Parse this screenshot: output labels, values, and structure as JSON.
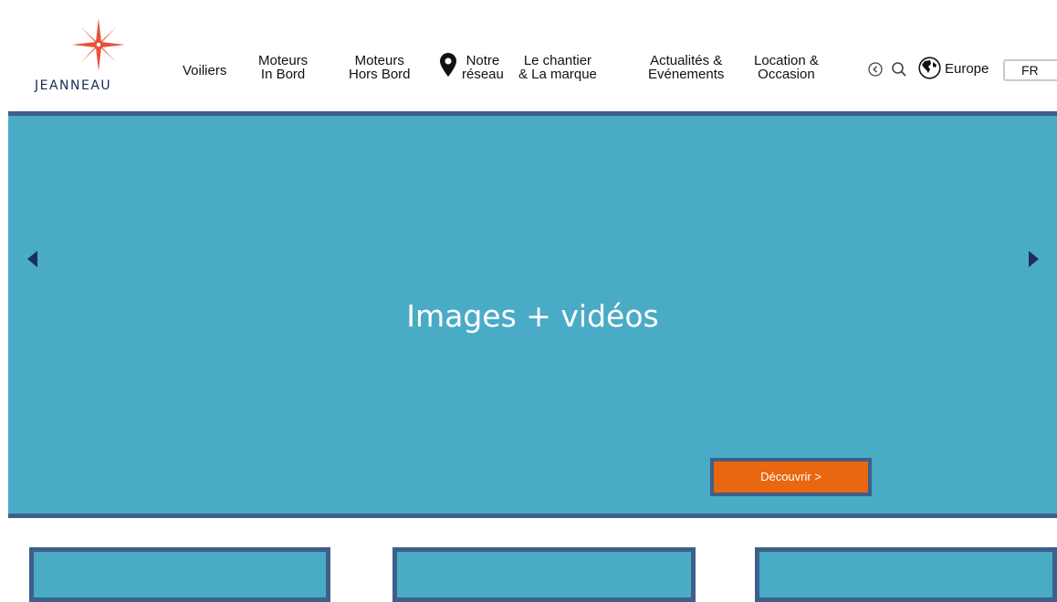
{
  "brand": {
    "name": "Jeanneau",
    "logo_text": "JEANNEAU"
  },
  "nav": {
    "voiliers": "Voiliers",
    "moteurs_in_bord": [
      "Moteurs",
      "In Bord"
    ],
    "moteurs_hors_bord": [
      "Moteurs",
      "Hors Bord"
    ],
    "reseau": [
      "Notre",
      "réseau"
    ],
    "chantier": [
      "Le chantier",
      "& La marque"
    ],
    "actualites": [
      "Actualités  &",
      "Evénements"
    ],
    "location": [
      "Location &",
      "Occasion"
    ]
  },
  "utilities": {
    "region": "Europe",
    "language": "FR"
  },
  "hero": {
    "title": "Images + vidéos",
    "cta_label": "Découvrir >"
  },
  "colors": {
    "hero_bg": "#4aabc6",
    "border": "#3d5f8a",
    "cta": "#e8670f",
    "logo_star": "#e8503a"
  },
  "icons": [
    "compass-star-icon",
    "map-pin-icon",
    "left-circle-icon",
    "search-icon",
    "globe-icon",
    "arrow-left-icon",
    "arrow-right-icon"
  ]
}
